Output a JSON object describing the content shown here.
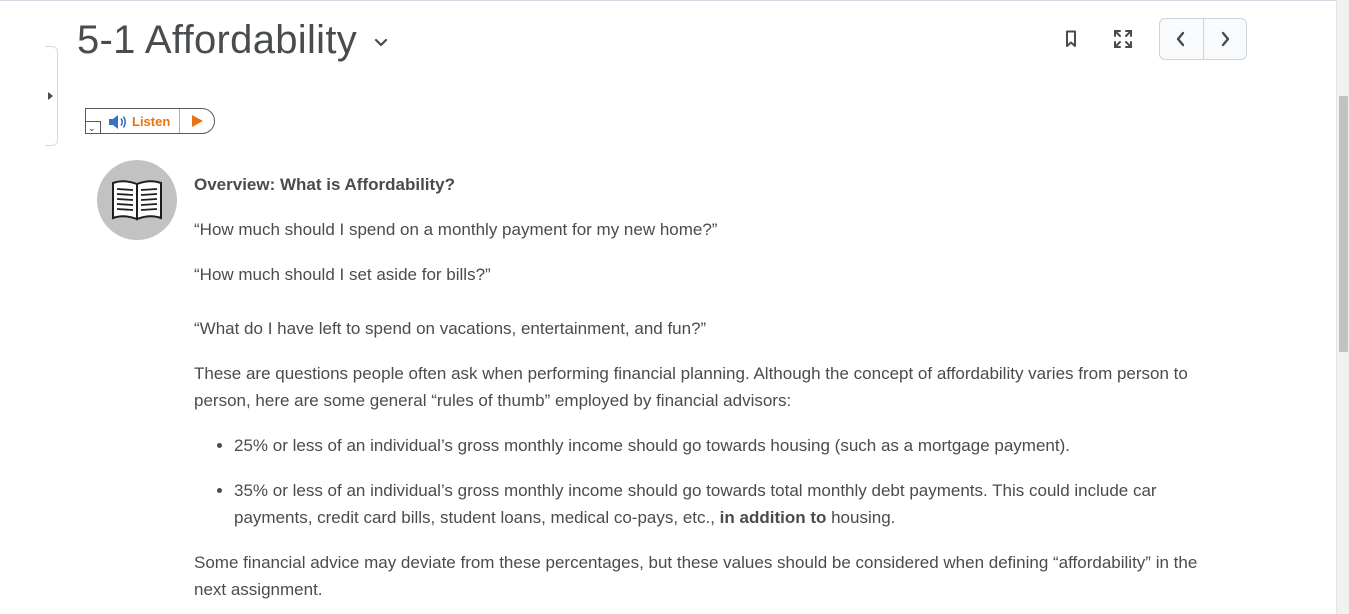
{
  "header": {
    "title": "5-1 Affordability"
  },
  "listen_widget": {
    "label": "Listen"
  },
  "content": {
    "heading": "Overview: What is Affordability?",
    "q1": "“How much should I spend on a monthly payment for my new home?”",
    "q2": "“How much should I set aside for bills?”",
    "q3": "“What do I have left to spend on vacations, entertainment, and fun?”",
    "intro": "These are questions people often ask when performing financial planning. Although the concept of affordability varies from person to person, here are some general “rules of thumb” employed by financial advisors:",
    "bullet1": "25% or less of an individual’s gross monthly income should go towards housing (such as a mortgage payment).",
    "bullet2_pre": "35% or less of an individual’s gross monthly income should go towards total monthly debt payments. This could include car payments, credit card bills, student loans, medical co-pays, etc., ",
    "bullet2_bold": "in addition to",
    "bullet2_post": " housing.",
    "closing": "Some financial advice may deviate from these percentages, but these values should be considered when defining “affordability” in the next assignment."
  },
  "icons": {
    "dropdown": "chevron-down-icon",
    "bookmark": "bookmark-icon",
    "fullscreen": "fullscreen-icon",
    "prev": "chevron-left-icon",
    "next": "chevron-right-icon",
    "book": "book-icon",
    "speaker": "speaker-icon",
    "play": "play-icon"
  },
  "colors": {
    "text": "#494c4e",
    "listen_accent": "#e87311",
    "speaker_blue": "#3a6fc4",
    "icon_circle": "#c2c2c2"
  }
}
